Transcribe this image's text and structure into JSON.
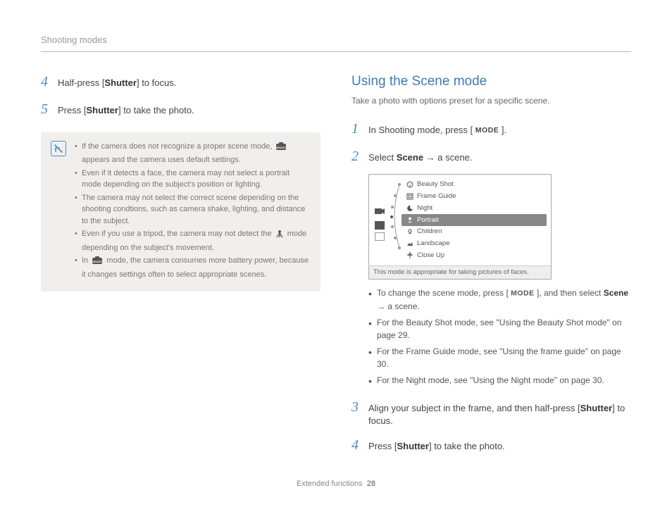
{
  "header": {
    "title": "Shooting modes"
  },
  "left": {
    "step4": {
      "num": "4",
      "text_before": "Half-press [",
      "bold": "Shutter",
      "text_after": "] to focus."
    },
    "step5": {
      "num": "5",
      "text_before": "Press [",
      "bold": "Shutter",
      "text_after": "] to take the photo."
    },
    "notes": {
      "n1a": "If the camera does not recognize a proper scene mode, ",
      "n1b": " appears and the camera uses default settings.",
      "n2": "Even if it detects a face, the camera may not select a portrait mode depending on the subject's position or lighting.",
      "n3": "The camera may not select the correct scene depending on the shooting condtions, such as camera shake, lighting, and distance to the subject.",
      "n4a": "Even if you use a tripod, the camera may not detect the ",
      "n4b": " mode depending on the subject's movement.",
      "n5a": "In ",
      "n5b": " mode, the camera consumes more battery power, because it changes settings often to select appropriate scenes."
    }
  },
  "right": {
    "title": "Using the Scene mode",
    "subtitle": "Take a photo with options preset for a specific scene.",
    "step1": {
      "num": "1",
      "text_before": "In Shooting mode, press [ ",
      "mode": "MODE",
      "text_after": " ]."
    },
    "step2": {
      "num": "2",
      "text_before": "Select ",
      "bold": "Scene",
      "text_after": " → a scene."
    },
    "scene_items": [
      {
        "label": "Beauty Shot"
      },
      {
        "label": "Frame Guide"
      },
      {
        "label": "Night"
      },
      {
        "label": "Portrait",
        "selected": true
      },
      {
        "label": "Children"
      },
      {
        "label": "Landscape"
      },
      {
        "label": "Close Up"
      }
    ],
    "scene_hint": "This mode is appropriate for taking pictures of faces.",
    "tips": {
      "t1a": "To change the scene mode, press [ ",
      "t1_mode": "MODE",
      "t1b": " ], and then select ",
      "t1_bold": "Scene",
      "t1c": " → a scene.",
      "t2": "For the Beauty Shot mode, see \"Using the Beauty Shot mode\" on page 29.",
      "t3": "For the Frame Guide mode, see \"Using the frame guide\" on page 30.",
      "t4": "For the Night mode, see \"Using the Night mode\" on page 30."
    },
    "step3": {
      "num": "3",
      "text_before": "Align your subject in the frame, and then half-press [",
      "bold": "Shutter",
      "text_after": "] to focus."
    },
    "step4": {
      "num": "4",
      "text_before": "Press [",
      "bold": "Shutter",
      "text_after": "] to take the photo."
    }
  },
  "footer": {
    "label": "Extended functions",
    "page": "28"
  }
}
